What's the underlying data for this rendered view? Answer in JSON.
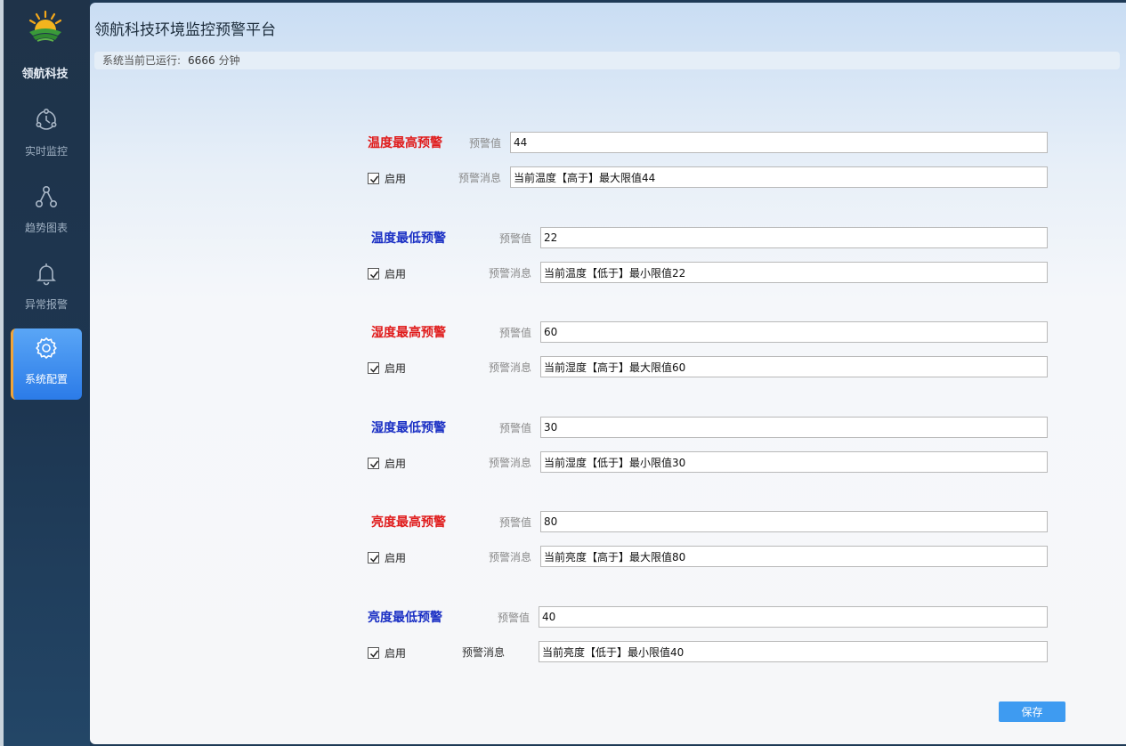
{
  "sidebar": {
    "brand": "领航科技",
    "items": [
      {
        "label": "实时监控",
        "icon": "monitor-icon",
        "active": false
      },
      {
        "label": "趋势图表",
        "icon": "trend-icon",
        "active": false
      },
      {
        "label": "异常报警",
        "icon": "bell-icon",
        "active": false
      },
      {
        "label": "系统配置",
        "icon": "gear-icon",
        "active": true
      }
    ]
  },
  "header": {
    "title": "领航科技环境监控预警平台",
    "runtime_label": "系统当前已运行:",
    "runtime_value": "6666",
    "runtime_unit": "分钟"
  },
  "alarms": [
    {
      "title": "温度最高预警",
      "kind": "high",
      "value_label": "预警值",
      "value": "44",
      "enable_label": "启用",
      "enabled": true,
      "message_label": "预警消息",
      "message": "当前温度【高于】最大限值44"
    },
    {
      "title": "温度最低预警",
      "kind": "low",
      "value_label": "预警值",
      "value": "22",
      "enable_label": "启用",
      "enabled": true,
      "message_label": "预警消息",
      "message": "当前温度【低于】最小限值22"
    },
    {
      "title": "湿度最高预警",
      "kind": "high",
      "value_label": "预警值",
      "value": "60",
      "enable_label": "启用",
      "enabled": true,
      "message_label": "预警消息",
      "message": "当前湿度【高于】最大限值60"
    },
    {
      "title": "湿度最低预警",
      "kind": "low",
      "value_label": "预警值",
      "value": "30",
      "enable_label": "启用",
      "enabled": true,
      "message_label": "预警消息",
      "message": "当前湿度【低于】最小限值30"
    },
    {
      "title": "亮度最高预警",
      "kind": "high",
      "value_label": "预警值",
      "value": "80",
      "enable_label": "启用",
      "enabled": true,
      "message_label": "预警消息",
      "message": "当前亮度【高于】最大限值80"
    },
    {
      "title": "亮度最低预警",
      "kind": "low",
      "value_label": "预警值",
      "value": "40",
      "enable_label": "启用",
      "enabled": true,
      "message_label": "预警消息",
      "message": "当前亮度【低于】最小限值40"
    }
  ],
  "actions": {
    "save_label": "保存"
  },
  "colors": {
    "high_title": "#e01b1b",
    "low_title": "#1a2fc4",
    "accent": "#3e9bf1",
    "active_nav": "#2b7be8"
  }
}
